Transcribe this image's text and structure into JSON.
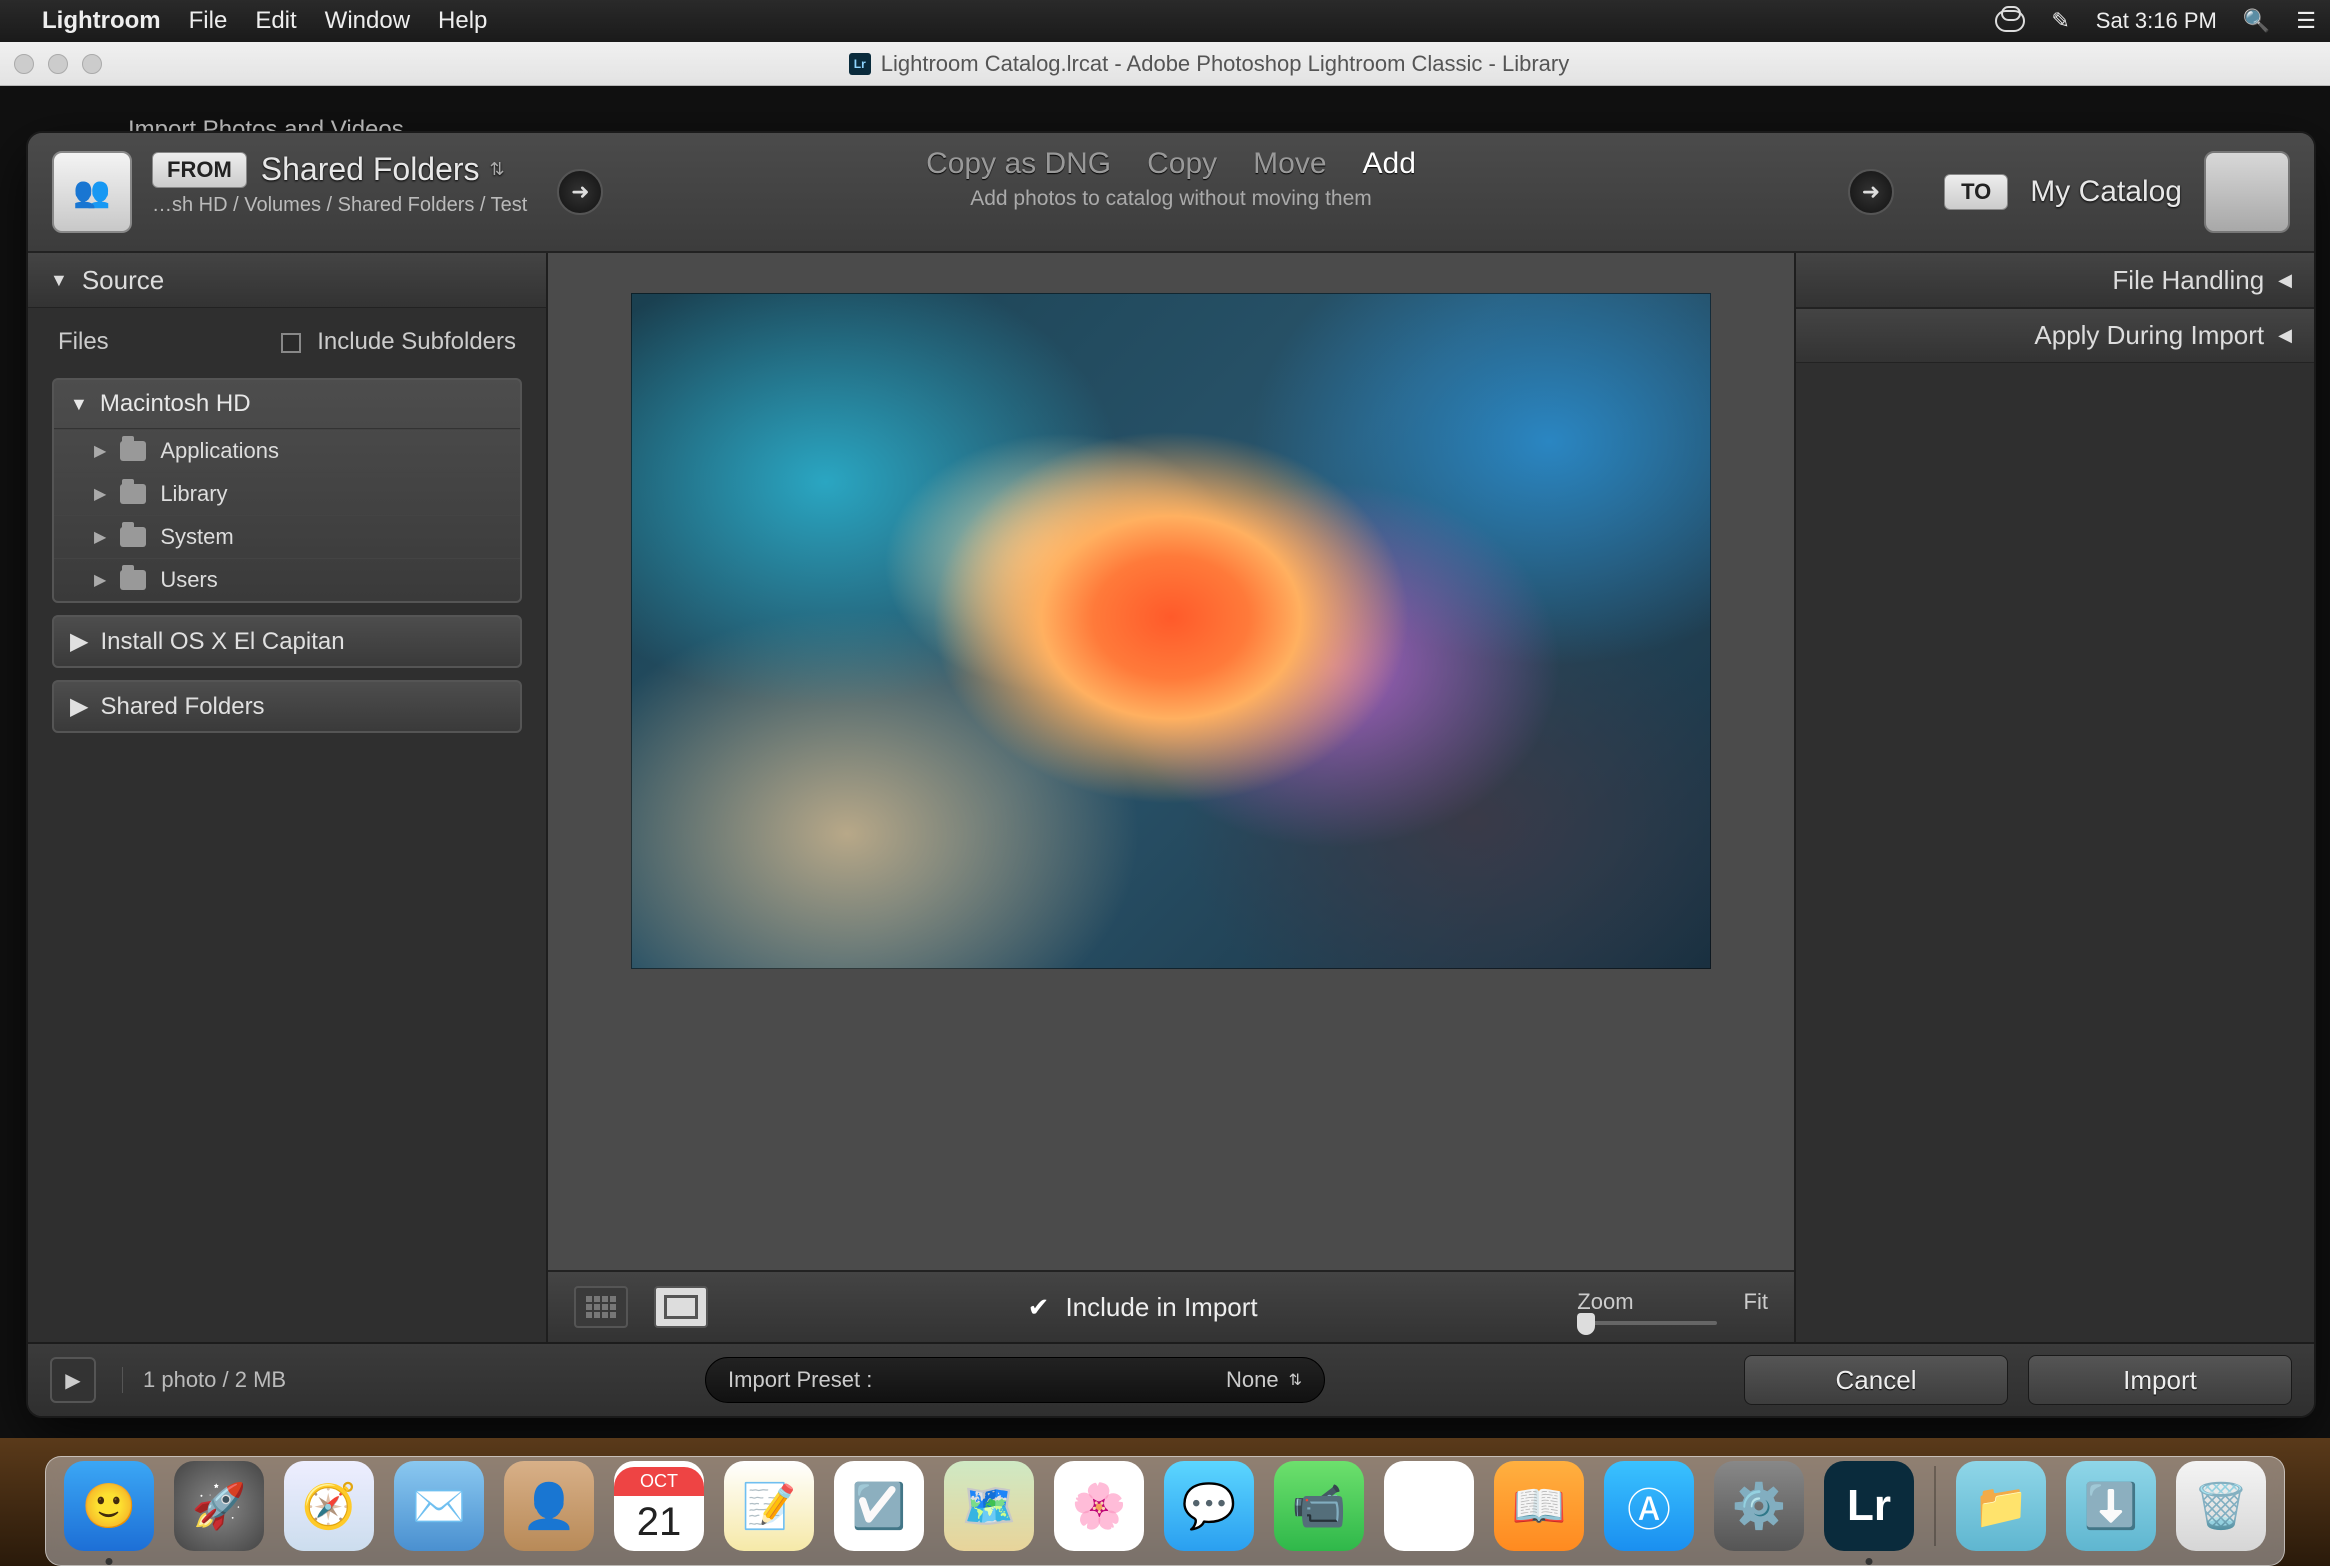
{
  "menubar": {
    "app": "Lightroom",
    "items": [
      "File",
      "Edit",
      "Window",
      "Help"
    ],
    "clock": "Sat 3:16 PM"
  },
  "window": {
    "title": "Lightroom Catalog.lrcat - Adobe Photoshop Lightroom Classic - Library"
  },
  "behind_dialog_label": "Import Photos and Videos",
  "import": {
    "from_badge": "FROM",
    "from_title": "Shared Folders",
    "from_path": "…sh HD / Volumes / Shared Folders / Test",
    "ops": {
      "copy_dng": "Copy as DNG",
      "copy": "Copy",
      "move": "Move",
      "add": "Add",
      "subtitle": "Add photos to catalog without moving them",
      "active": "add"
    },
    "to_badge": "TO",
    "to_title": "My Catalog"
  },
  "left_panel": {
    "header": "Source",
    "files_label": "Files",
    "include_subfolders": "Include Subfolders",
    "root": "Macintosh HD",
    "children": [
      "Applications",
      "Library",
      "System",
      "Users"
    ],
    "extra": [
      "Install OS X El Capitan",
      "Shared Folders"
    ]
  },
  "right_panel": {
    "file_handling": "File Handling",
    "apply_during_import": "Apply During Import"
  },
  "center": {
    "include_label": "Include in Import",
    "zoom_label": "Zoom",
    "fit_label": "Fit"
  },
  "footer": {
    "count": "1 photo / 2 MB",
    "preset_label": "Import Preset :",
    "preset_value": "None",
    "cancel": "Cancel",
    "import": "Import"
  },
  "dock": {
    "calendar_month": "OCT",
    "calendar_day": "21",
    "lr": "Lr"
  }
}
